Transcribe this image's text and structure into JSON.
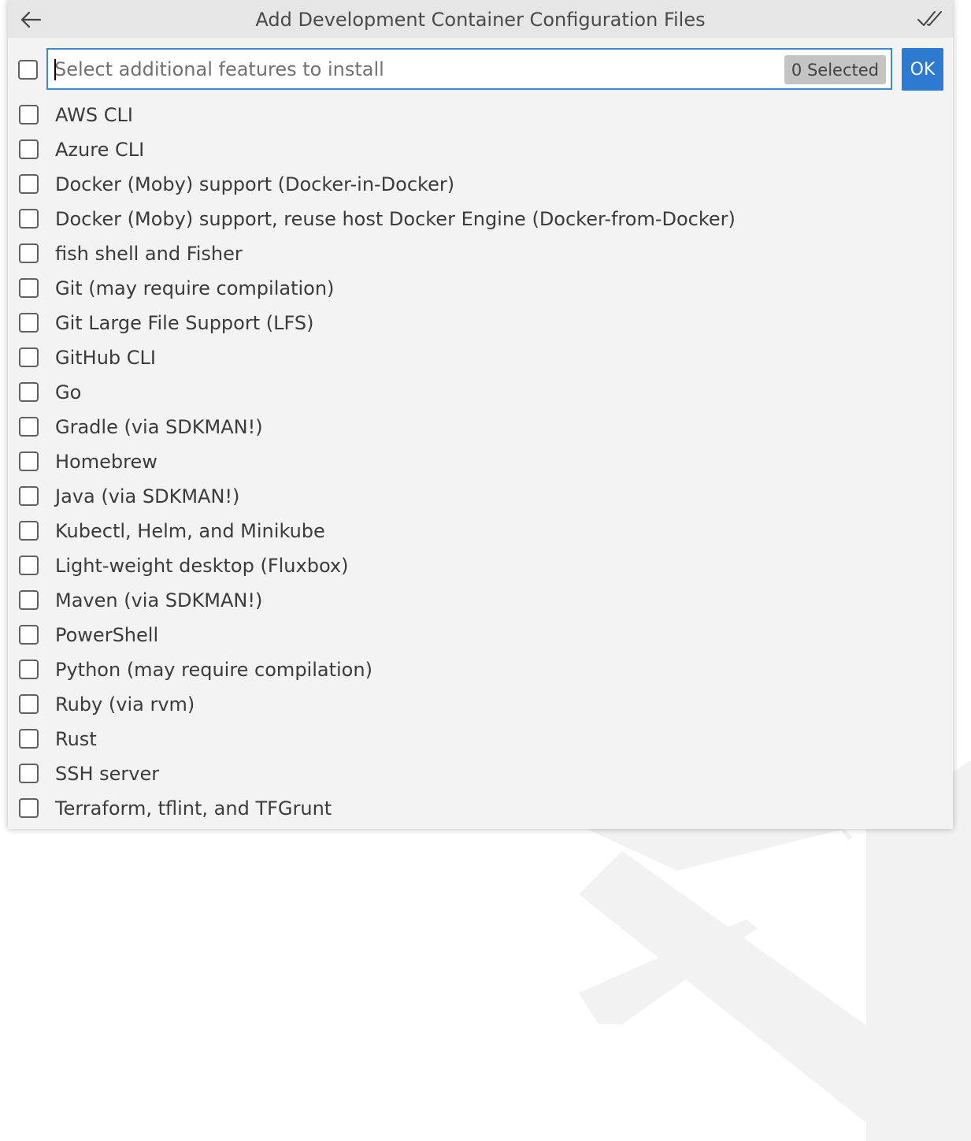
{
  "window": {
    "title": "Add Development Container Configuration Files",
    "back_icon": "arrow-left-icon",
    "toggle_all_icon": "check-all-icon"
  },
  "filter": {
    "value": "",
    "placeholder": "Select additional features to install",
    "selected_count": "0 Selected"
  },
  "ok_label": "OK",
  "features": [
    {
      "label": "AWS CLI",
      "checked": false
    },
    {
      "label": "Azure CLI",
      "checked": false
    },
    {
      "label": "Docker (Moby) support (Docker-in-Docker)",
      "checked": false
    },
    {
      "label": "Docker (Moby) support, reuse host Docker Engine (Docker-from-Docker)",
      "checked": false
    },
    {
      "label": "fish shell and Fisher",
      "checked": false
    },
    {
      "label": "Git (may require compilation)",
      "checked": false
    },
    {
      "label": "Git Large File Support (LFS)",
      "checked": false
    },
    {
      "label": "GitHub CLI",
      "checked": false
    },
    {
      "label": "Go",
      "checked": false
    },
    {
      "label": "Gradle (via SDKMAN!)",
      "checked": false
    },
    {
      "label": "Homebrew",
      "checked": false
    },
    {
      "label": "Java (via SDKMAN!)",
      "checked": false
    },
    {
      "label": "Kubectl, Helm, and Minikube",
      "checked": false
    },
    {
      "label": "Light-weight desktop (Fluxbox)",
      "checked": false
    },
    {
      "label": "Maven (via SDKMAN!)",
      "checked": false
    },
    {
      "label": "PowerShell",
      "checked": false
    },
    {
      "label": "Python (may require compilation)",
      "checked": false
    },
    {
      "label": "Ruby (via rvm)",
      "checked": false
    },
    {
      "label": "Rust",
      "checked": false
    },
    {
      "label": "SSH server",
      "checked": false
    },
    {
      "label": "Terraform, tflint, and TFGrunt",
      "checked": false
    }
  ],
  "colors": {
    "accent": "#2d7ad1",
    "focus_border": "#3a8bd5",
    "panel_bg": "#f3f3f3",
    "title_bg": "#e6e6e6"
  }
}
